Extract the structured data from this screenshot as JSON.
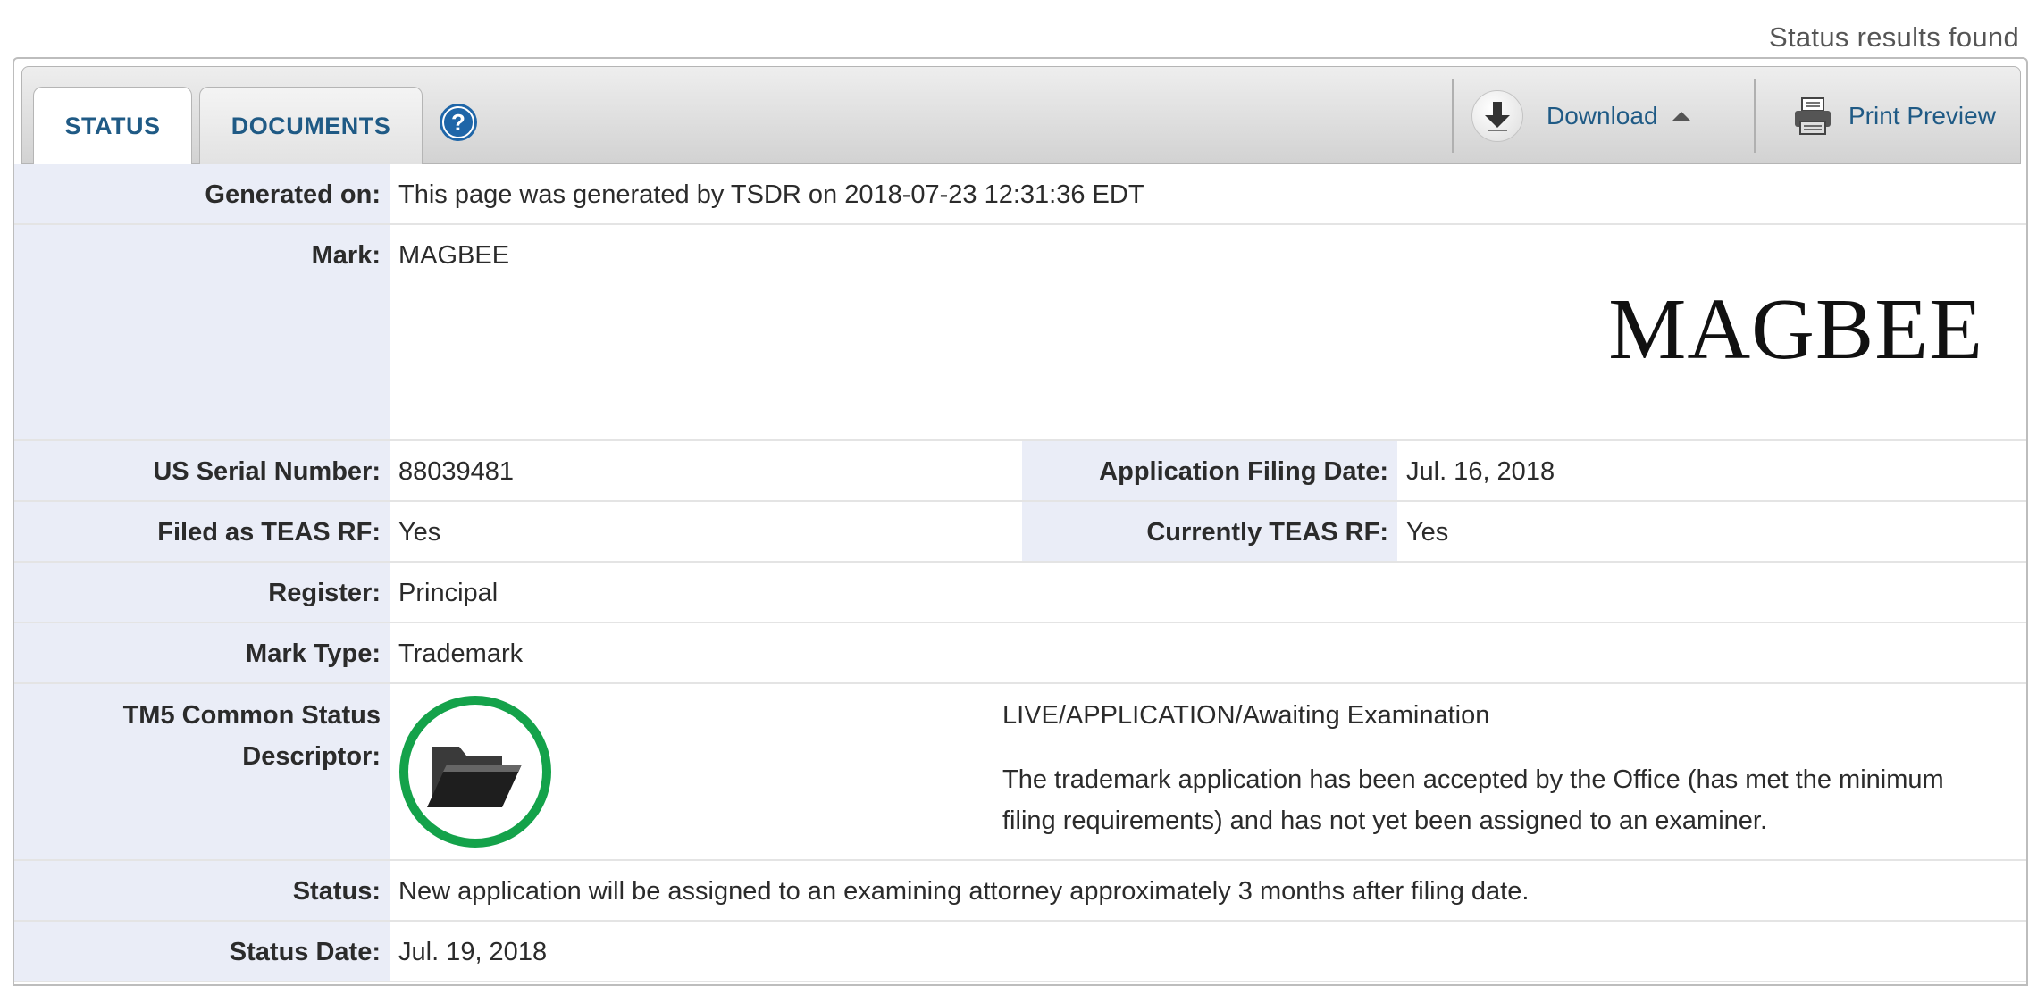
{
  "header": {
    "results_found": "Status results found"
  },
  "tabs": [
    {
      "label": "STATUS",
      "active": true
    },
    {
      "label": "DOCUMENTS",
      "active": false
    }
  ],
  "toolbar": {
    "help_icon": "question-circle-icon",
    "download_label": "Download",
    "print_preview_label": "Print Preview"
  },
  "fields": {
    "generated_on": {
      "label": "Generated on:",
      "value": "This page was generated by TSDR on 2018-07-23 12:31:36 EDT"
    },
    "mark": {
      "label": "Mark:",
      "value": "MAGBEE",
      "image_text": "MAGBEE"
    },
    "serial_number": {
      "label": "US Serial Number:",
      "value": "88039481"
    },
    "filing_date": {
      "label": "Application Filing Date:",
      "value": "Jul. 16, 2018"
    },
    "filed_teas_rf": {
      "label": "Filed as TEAS RF:",
      "value": "Yes"
    },
    "currently_teas_rf": {
      "label": "Currently TEAS RF:",
      "value": "Yes"
    },
    "register": {
      "label": "Register:",
      "value": "Principal"
    },
    "mark_type": {
      "label": "Mark Type:",
      "value": "Trademark"
    },
    "tm5": {
      "label_line1": "TM5 Common Status",
      "label_line2": "Descriptor:",
      "code": "LIVE/APPLICATION/Awaiting Examination",
      "description": "The trademark application has been accepted by the Office (has met the minimum filing requirements) and has not yet been assigned to an examiner.",
      "icon": "folder-icon",
      "ring_color": "#16a34a"
    },
    "status": {
      "label": "Status:",
      "value": "New application will be assigned to an examining attorney approximately 3 months after filing date."
    },
    "status_date": {
      "label": "Status Date:",
      "value": "Jul. 19, 2018"
    }
  },
  "colors": {
    "link": "#1f5a85",
    "label_bg": "#eaedf7"
  }
}
